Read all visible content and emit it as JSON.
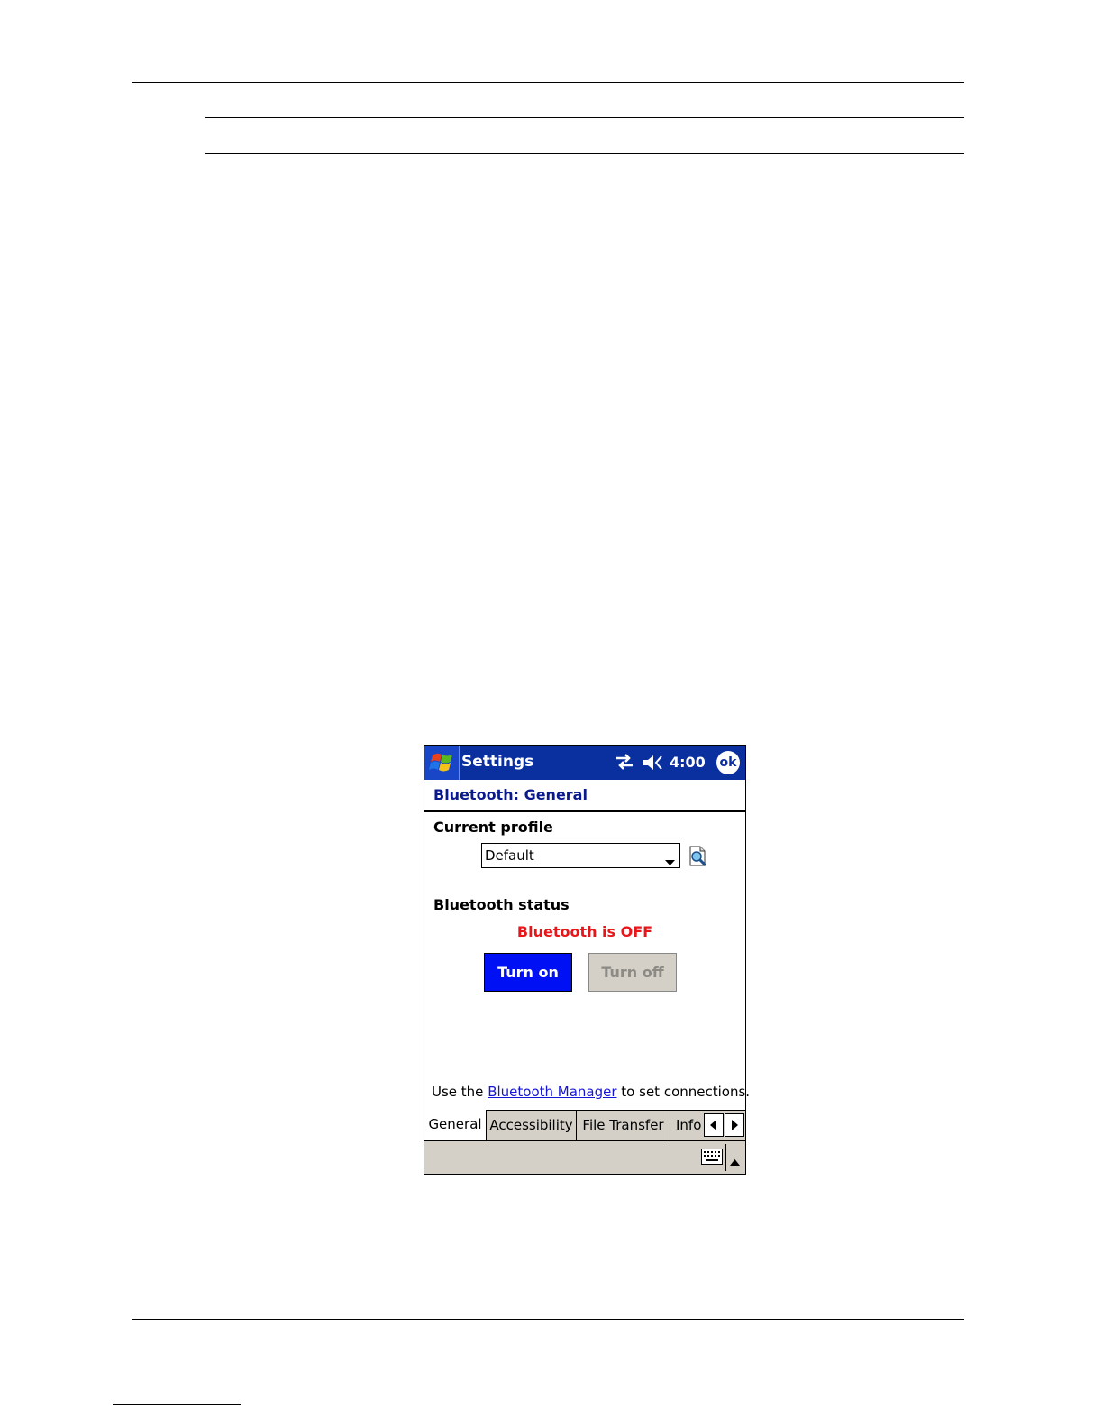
{
  "device": {
    "title_bar": {
      "app_title": "Settings",
      "clock": "4:00",
      "ok_label": "ok",
      "icons": [
        "windows-start-icon",
        "sync-icon",
        "volume-muted-icon"
      ]
    },
    "heading": "Bluetooth: General",
    "profile": {
      "label": "Current profile",
      "selected": "Default"
    },
    "status": {
      "label": "Bluetooth status",
      "text": "Bluetooth is OFF"
    },
    "buttons": {
      "turn_on": "Turn on",
      "turn_off": "Turn off"
    },
    "manager_line": {
      "prefix": "Use the ",
      "link": "Bluetooth Manager",
      "suffix": " to set connections."
    },
    "tabs": [
      {
        "label": "General",
        "active": true
      },
      {
        "label": "Accessibility",
        "active": false
      },
      {
        "label": "File Transfer",
        "active": false
      },
      {
        "label": "Info",
        "active": false
      }
    ],
    "colors": {
      "title_bar": "#0a2f9e",
      "heading": "#0a1a8c",
      "status_off": "#e8161a",
      "turn_on_button": "#0010f5",
      "link": "#1515d4",
      "chrome_gray": "#d4d0c8"
    }
  }
}
